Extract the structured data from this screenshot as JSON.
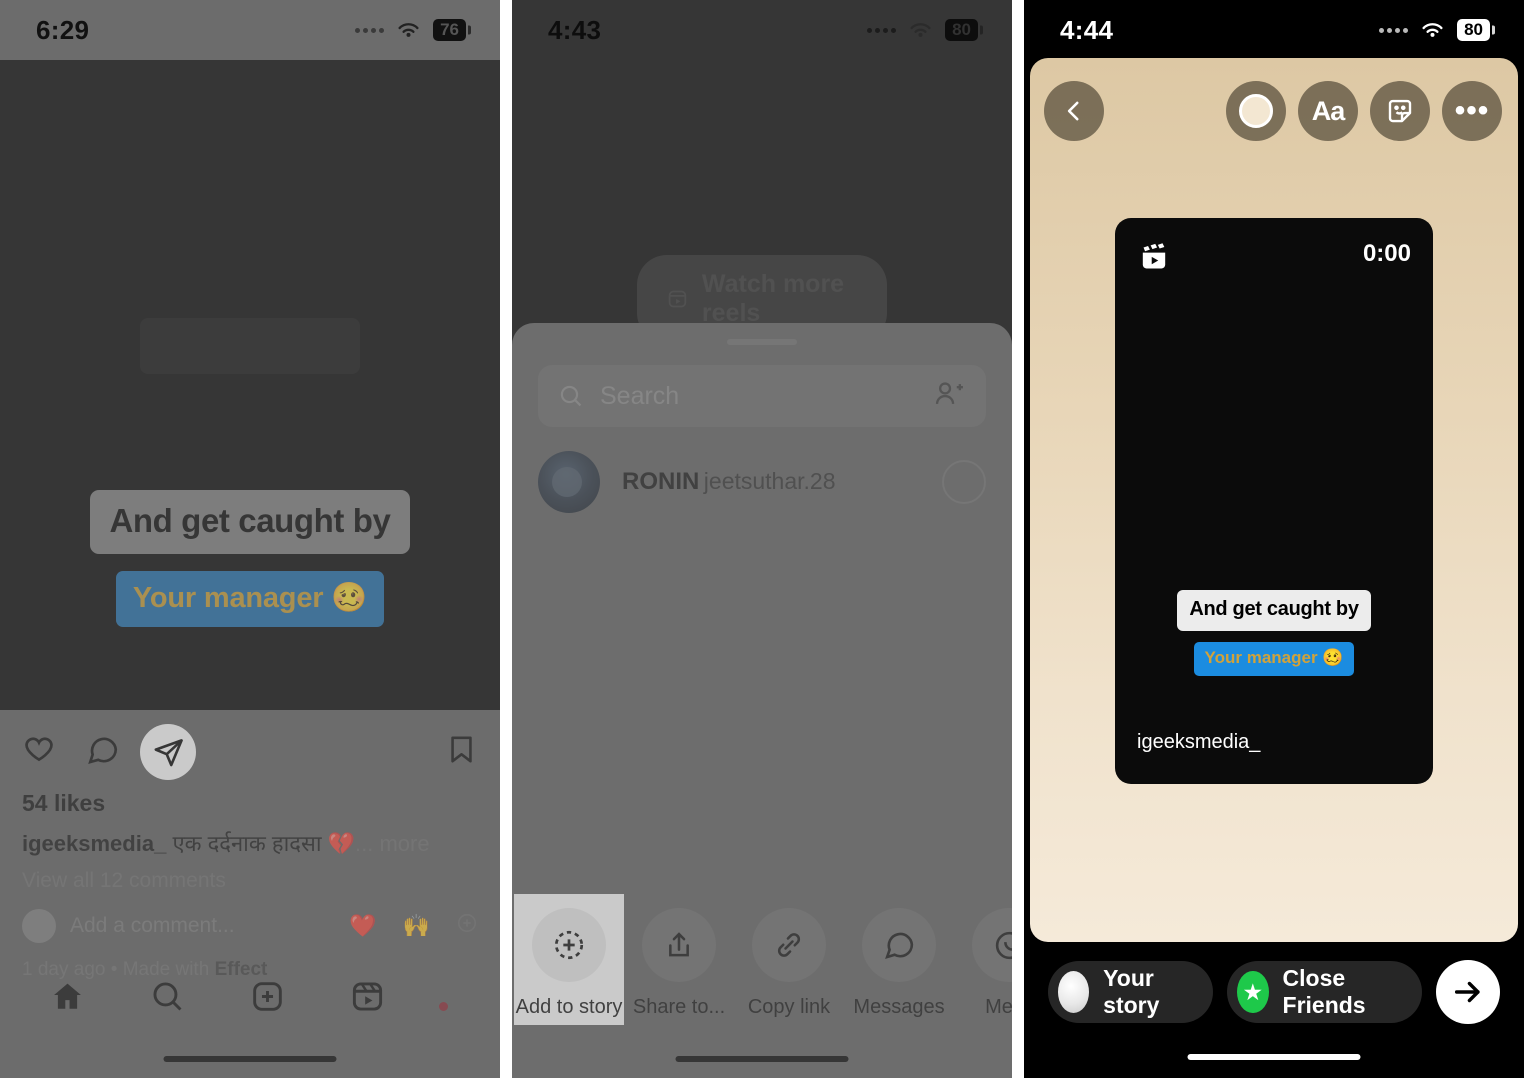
{
  "panel1": {
    "status": {
      "time": "6:29",
      "battery": "76",
      "wifi_icon": "wifi-icon",
      "signal_icon": "signal-dots-icon"
    },
    "post": {
      "caption_overlay_1": "And get caught by",
      "caption_overlay_2": "Your manager 🥴",
      "likes": "54 likes",
      "author": "igeeksmedia_",
      "caption_text": "एक दर्दनाक हादसा 💔",
      "caption_more": "... more",
      "view_comments": "View all 12 comments",
      "add_comment_placeholder": "Add a comment...",
      "quick_emoji_1": "❤️",
      "quick_emoji_2": "🙌",
      "timestamp": "1 day ago",
      "separator": "•",
      "made_with": "Made with",
      "effect": "Effect"
    },
    "actions": {
      "like_icon": "heart-icon",
      "comment_icon": "comment-icon",
      "share_icon": "share-paperplane-icon",
      "save_icon": "bookmark-icon",
      "mute_icon": "speaker-muted-icon"
    },
    "tabbar": {
      "home_icon": "home-icon",
      "search_icon": "search-icon",
      "create_icon": "plus-square-icon",
      "reels_icon": "reels-icon",
      "profile_icon": "profile-avatar-icon"
    }
  },
  "panel2": {
    "status": {
      "time": "4:43",
      "battery": "80",
      "wifi_icon": "wifi-icon",
      "signal_icon": "signal-dots-icon"
    },
    "watch_more": {
      "label": "Watch more reels",
      "icon": "reels-icon"
    },
    "sheet": {
      "search_placeholder": "Search",
      "search_icon": "search-icon",
      "add_people_icon": "add-people-icon",
      "contact": {
        "name": "RONIN",
        "handle": "jeetsuthar.28",
        "avatar": "contact-avatar",
        "select_toggle": "select-circle"
      }
    },
    "share_actions": [
      {
        "label": "Add to story",
        "icon": "add-to-story-icon",
        "highlighted": true
      },
      {
        "label": "Share to...",
        "icon": "share-up-icon",
        "highlighted": false
      },
      {
        "label": "Copy link",
        "icon": "link-icon",
        "highlighted": false
      },
      {
        "label": "Messages",
        "icon": "message-bubble-icon",
        "highlighted": false
      },
      {
        "label": "Mess",
        "icon": "whatsapp-icon",
        "highlighted": false
      }
    ]
  },
  "panel3": {
    "status": {
      "time": "4:44",
      "battery": "80",
      "wifi_icon": "wifi-icon",
      "signal_icon": "signal-dots-icon"
    },
    "toolbar": {
      "back_icon": "chevron-left-icon",
      "color_picker_icon": "color-swatch-icon",
      "text_icon": "text-aa-icon",
      "sticker_icon": "sticker-smiley-icon",
      "more_icon": "more-dots-icon"
    },
    "card": {
      "reels_icon": "reels-icon",
      "duration": "0:00",
      "overlay_1": "And get caught by",
      "overlay_2": "Your manager 🥴",
      "username": "igeeksmedia_"
    },
    "footer": {
      "your_story_label": "Your story",
      "your_story_avatar": "your-story-avatar",
      "close_friends_label": "Close Friends",
      "close_friends_icon": "close-friends-star-icon",
      "next_icon": "arrow-right-icon"
    }
  },
  "colors": {
    "instagram_blue": "#1b8ce0",
    "close_friends_green": "#1ec94a",
    "story_bg_top": "#ddc8a4",
    "story_bg_bottom": "#f5ead9"
  }
}
